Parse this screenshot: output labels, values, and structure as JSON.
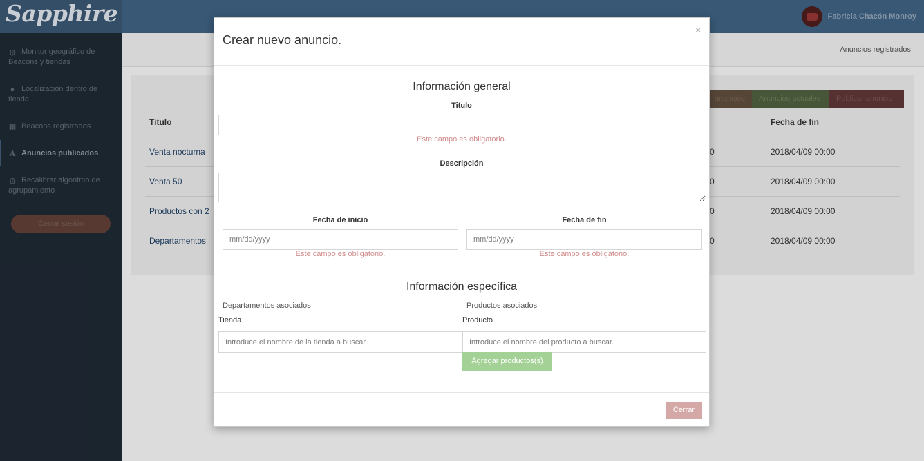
{
  "app": {
    "logo": "Sapphire",
    "user_name": "Fabricia Chacón Monroy"
  },
  "sidebar": {
    "items": [
      {
        "icon": "globe-icon",
        "label": "Monitor geográfico de Beacons y tiendas",
        "active": false
      },
      {
        "icon": "user-icon",
        "label": "Localización dentro de tienda",
        "active": false
      },
      {
        "icon": "table-icon",
        "label": "Beacons registrados",
        "active": false
      },
      {
        "icon": "font-icon",
        "label": "Anuncios publicados",
        "active": true
      },
      {
        "icon": "globe-icon",
        "label": "Recalibrar algoritmo de agrupamiento",
        "active": false
      }
    ],
    "logout_label": "Cerrar sesión"
  },
  "header": {
    "breadcrumb": "Anuncios registrados"
  },
  "main": {
    "tab_buttons": [
      "anuncios",
      "Anuncios actuales",
      "Publicar anuncio"
    ],
    "table": {
      "columns": [
        "Titulo",
        "Fecha de fin"
      ],
      "rows": [
        {
          "title": "Venta nocturna",
          "mid": "0",
          "end": "2018/04/09 00:00"
        },
        {
          "title": "Venta 50",
          "mid": "0",
          "end": "2018/04/09 00:00"
        },
        {
          "title": "Productos con 2",
          "mid": "0",
          "end": "2018/04/09 00:00"
        },
        {
          "title": "Departamentos",
          "mid": "0",
          "end": "2018/04/09 00:00"
        }
      ]
    }
  },
  "modal": {
    "title": "Crear nuevo anuncio.",
    "close_symbol": "×",
    "general_section": "Información general",
    "title_label": "Titulo",
    "title_value": "",
    "required_error": "Este campo es obligatorio.",
    "description_label": "Descripción",
    "description_value": "",
    "start_label": "Fecha de inicio",
    "start_placeholder": "mm/dd/yyyy",
    "end_label": "Fecha de fin",
    "end_placeholder": "mm/dd/yyyy",
    "specific_section": "Información específica",
    "departments_label": "Departamentos asociados",
    "products_label": "Productos asociados",
    "store_label": "Tienda",
    "store_placeholder": "Introduce el nombre de la tienda a buscar.",
    "product_label": "Producto",
    "product_placeholder": "Introduce el nombre del producto a buscar.",
    "add_products_label": "Agregar productos(s)",
    "close_button_label": "Cerrar"
  }
}
